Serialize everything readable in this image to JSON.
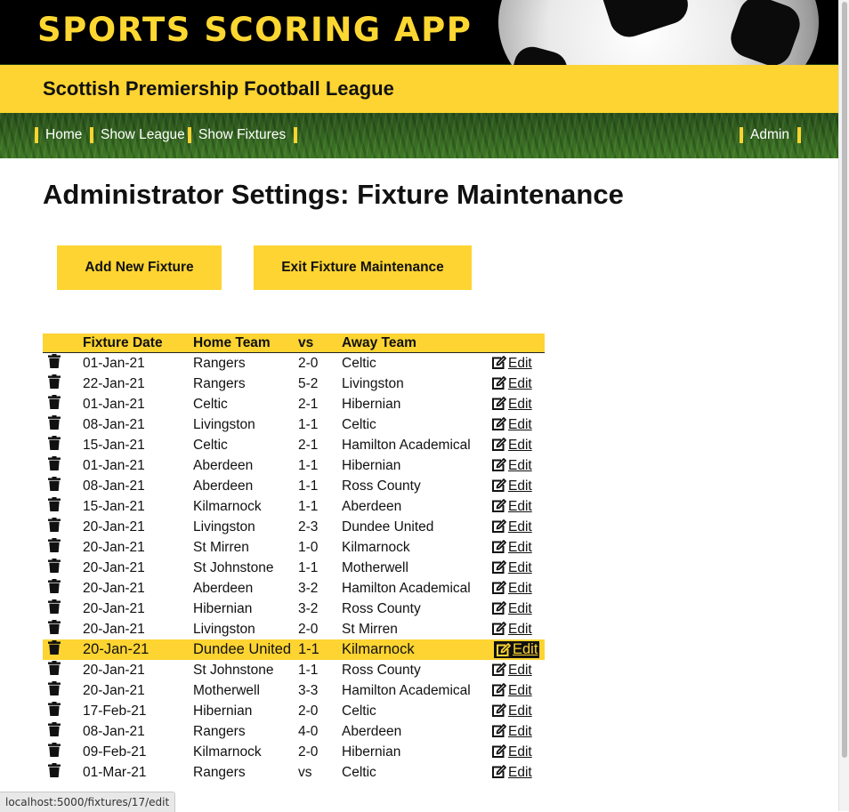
{
  "header": {
    "app_title": "SPORTS SCORING APP",
    "league_title": "Scottish Premiership Football League"
  },
  "nav": {
    "home": "Home",
    "show_league": "Show League",
    "show_fixtures": "Show Fixtures",
    "admin": "Admin"
  },
  "main": {
    "page_title": "Administrator Settings: Fixture Maintenance",
    "add_button": "Add New Fixture",
    "exit_button": "Exit Fixture Maintenance"
  },
  "table": {
    "headers": [
      "",
      "Fixture Date",
      "Home Team",
      "vs",
      "Away Team",
      ""
    ],
    "edit_label": "Edit",
    "rows": [
      {
        "date": "01-Jan-21",
        "home": "Rangers",
        "score": "2-0",
        "away": "Celtic"
      },
      {
        "date": "22-Jan-21",
        "home": "Rangers",
        "score": "5-2",
        "away": "Livingston"
      },
      {
        "date": "01-Jan-21",
        "home": "Celtic",
        "score": "2-1",
        "away": "Hibernian"
      },
      {
        "date": "08-Jan-21",
        "home": "Livingston",
        "score": "1-1",
        "away": "Celtic"
      },
      {
        "date": "15-Jan-21",
        "home": "Celtic",
        "score": "2-1",
        "away": "Hamilton Academical"
      },
      {
        "date": "01-Jan-21",
        "home": "Aberdeen",
        "score": "1-1",
        "away": "Hibernian"
      },
      {
        "date": "08-Jan-21",
        "home": "Aberdeen",
        "score": "1-1",
        "away": "Ross County"
      },
      {
        "date": "15-Jan-21",
        "home": "Kilmarnock",
        "score": "1-1",
        "away": "Aberdeen"
      },
      {
        "date": "20-Jan-21",
        "home": "Livingston",
        "score": "2-3",
        "away": "Dundee United"
      },
      {
        "date": "20-Jan-21",
        "home": "St Mirren",
        "score": "1-0",
        "away": "Kilmarnock"
      },
      {
        "date": "20-Jan-21",
        "home": "St Johnstone",
        "score": "1-1",
        "away": "Motherwell"
      },
      {
        "date": "20-Jan-21",
        "home": "Aberdeen",
        "score": "3-2",
        "away": "Hamilton Academical"
      },
      {
        "date": "20-Jan-21",
        "home": "Hibernian",
        "score": "3-2",
        "away": "Ross County"
      },
      {
        "date": "20-Jan-21",
        "home": "Livingston",
        "score": "2-0",
        "away": "St Mirren"
      },
      {
        "date": "20-Jan-21",
        "home": "Dundee United",
        "score": "1-1",
        "away": "Kilmarnock",
        "highlighted": true
      },
      {
        "date": "20-Jan-21",
        "home": "St Johnstone",
        "score": "1-1",
        "away": "Ross County"
      },
      {
        "date": "20-Jan-21",
        "home": "Motherwell",
        "score": "3-3",
        "away": "Hamilton Academical"
      },
      {
        "date": "17-Feb-21",
        "home": "Hibernian",
        "score": "2-0",
        "away": "Celtic"
      },
      {
        "date": "08-Jan-21",
        "home": "Rangers",
        "score": "4-0",
        "away": "Aberdeen"
      },
      {
        "date": "09-Feb-21",
        "home": "Kilmarnock",
        "score": "2-0",
        "away": "Hibernian"
      },
      {
        "date": "01-Mar-21",
        "home": "Rangers",
        "score": "vs",
        "away": "Celtic"
      }
    ]
  },
  "status_bar": {
    "url": "localhost:5000/fixtures/17/edit"
  },
  "colors": {
    "accent": "#fdd431",
    "dark": "#111111"
  },
  "icons": {
    "delete": "trash-icon",
    "edit": "edit-icon"
  }
}
